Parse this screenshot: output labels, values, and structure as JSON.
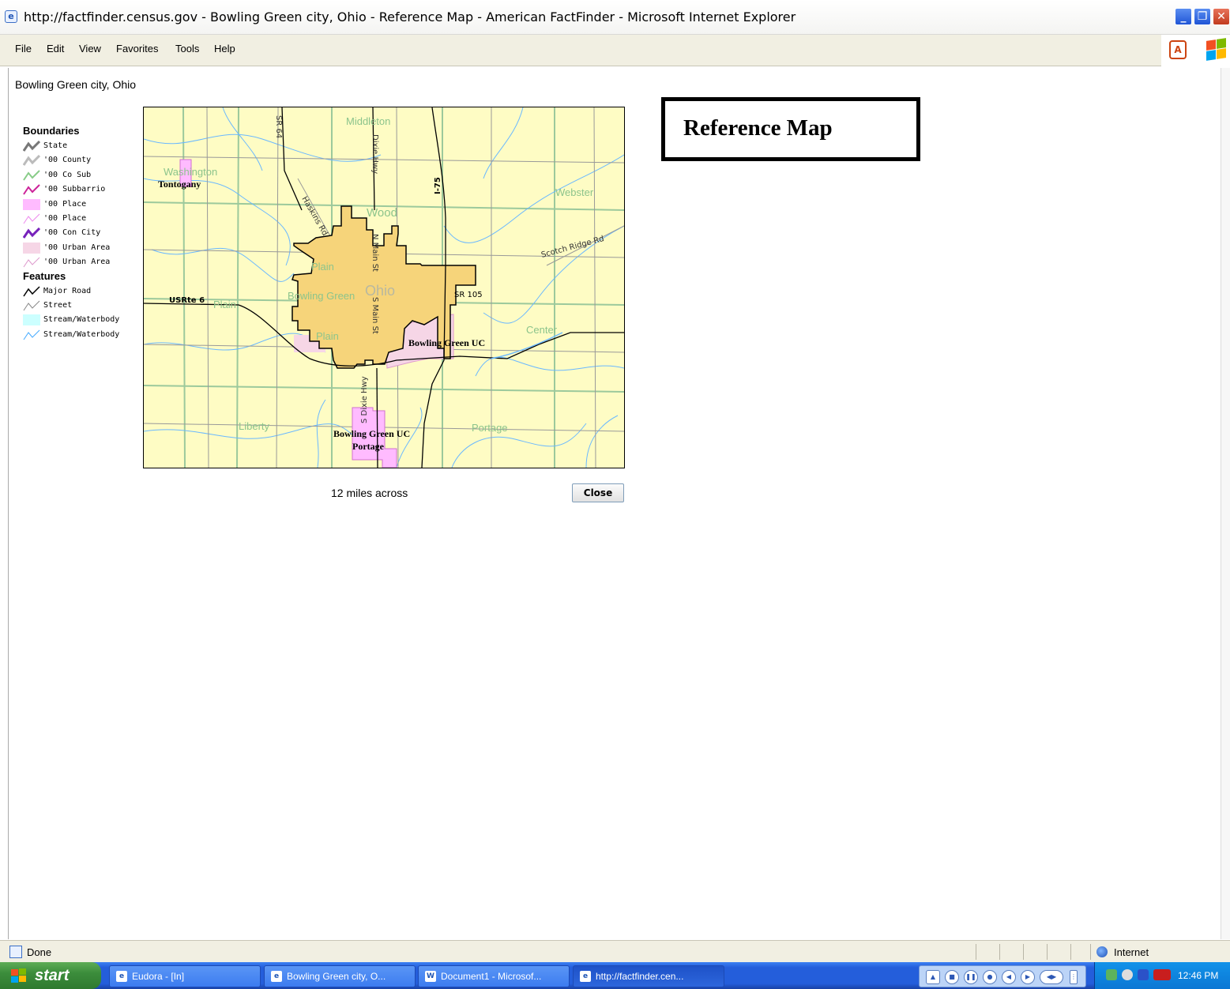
{
  "window": {
    "title": "http://factfinder.census.gov - Bowling Green city, Ohio - Reference Map - American FactFinder - Microsoft Internet Explorer",
    "controls": [
      "_",
      "❐",
      "✕"
    ]
  },
  "menu": {
    "items": [
      "File",
      "Edit",
      "View",
      "Favorites",
      "Tools",
      "Help"
    ]
  },
  "page": {
    "heading": "Bowling Green city, Ohio",
    "reference_title": "Reference Map",
    "scale_caption": "12 miles across",
    "close_label": "Close"
  },
  "legend": {
    "boundaries_title": "Boundaries",
    "boundaries": [
      {
        "label": "State",
        "color": "#777777"
      },
      {
        "label": "'00 County",
        "color": "#bbbbbb"
      },
      {
        "label": "'00 Co Sub",
        "color": "#88cc88"
      },
      {
        "label": "'00 Subbarrio",
        "color": "#cc2299"
      },
      {
        "label": "'00 Place",
        "color": "#ffbbff"
      },
      {
        "label": "'00 Place",
        "color": "#ee88ee"
      },
      {
        "label": "'00 Con City",
        "color": "#7722bb"
      },
      {
        "label": "'00 Urban Area",
        "color": "#f6d6e6"
      },
      {
        "label": "'00 Urban Area",
        "color": "#dd99cc"
      }
    ],
    "features_title": "Features",
    "features": [
      {
        "label": "Major Road",
        "color": "#000000"
      },
      {
        "label": "Street",
        "color": "#888888"
      },
      {
        "label": "Stream/Waterbody",
        "color": "#ccffff"
      },
      {
        "label": "Stream/Waterbody",
        "color": "#44aaff"
      }
    ]
  },
  "map": {
    "places": {
      "middleton": "Middleton",
      "washington": "Washington",
      "tontogany": "Tontogany",
      "webster": "Webster",
      "wood": "Wood",
      "ohio": "Ohio",
      "bowling_green": "Bowling Green",
      "plain_upper": "Plain",
      "plain_left": "Plain",
      "plain_lower": "Plain",
      "bg_uc_right": "Bowling Green UC",
      "center": "Center",
      "liberty": "Liberty",
      "bg_uc_bottom": "Bowling Green UC",
      "portage_twp": "Portage",
      "portage": "Portage"
    },
    "roads": {
      "sr64": "SR 64",
      "dixie_hwy": "Dixie Hwy",
      "i75": "I-75",
      "haskins": "Haskins Rd",
      "n_main": "N Main St",
      "scotch_ridge": "Scotch Ridge Rd",
      "usrte6": "USRte 6",
      "sr105": "SR 105",
      "s_main": "S Main St",
      "s_dixie": "S Dixie Hwy"
    },
    "colors": {
      "background": "#fefcc4",
      "city": "#f6d47a",
      "township_line": "#9cc99c",
      "stream": "#6ab8ff",
      "place_pink": "#ffbbff"
    }
  },
  "status": {
    "text": "Done",
    "zone": "Internet"
  },
  "taskbar": {
    "start": "start",
    "tasks": [
      {
        "label": "Eudora - [In]"
      },
      {
        "label": "Bowling Green city, O..."
      },
      {
        "label": "Document1 - Microsof..."
      },
      {
        "label": "http://factfinder.cen..."
      }
    ],
    "clock": "12:46 PM"
  }
}
